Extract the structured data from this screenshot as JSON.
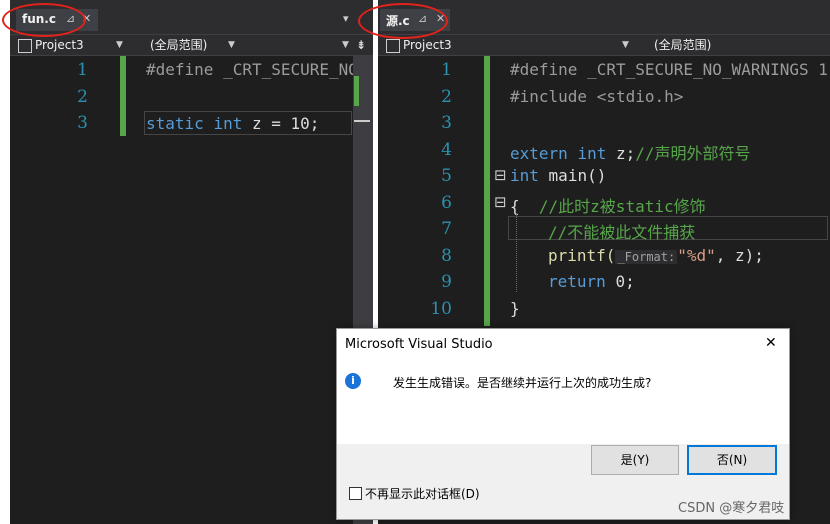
{
  "left_pane": {
    "tab": {
      "label": "fun.c",
      "pin": "⊿",
      "close": "✕"
    },
    "tab_menu": "▾",
    "nav": {
      "project": "Project3",
      "scope": "(全局范围)",
      "split": "⇟"
    },
    "lines": [
      {
        "num": "1",
        "code": "#define _CRT_SECURE_NO"
      },
      {
        "num": "2",
        "code": ""
      },
      {
        "num": "3",
        "code_kw1": "static",
        "code_kw2": "int",
        "code_rest": "z = 10;"
      }
    ]
  },
  "right_pane": {
    "tab": {
      "label": "源.c",
      "pin": "⊿",
      "close": "✕"
    },
    "nav": {
      "project": "Project3",
      "scope": "(全局范围)"
    },
    "lines": [
      {
        "num": "1",
        "code": "#define _CRT_SECURE_NO_WARNINGS 1"
      },
      {
        "num": "2",
        "code": "#include <stdio.h>"
      },
      {
        "num": "3",
        "code": ""
      },
      {
        "num": "4",
        "kw1": "extern",
        "kw2": "int",
        "rest": "z;",
        "comment": "//声明外部符号"
      },
      {
        "num": "5",
        "kw1": "int",
        "rest": "main()"
      },
      {
        "num": "6",
        "rest": "{",
        "comment": "//此时z被static修饰"
      },
      {
        "num": "7",
        "comment": "//不能被此文件捕获"
      },
      {
        "num": "8",
        "fn": "printf(",
        "hint": "_Format:",
        "str": "\"%d\"",
        "rest": ", z);"
      },
      {
        "num": "9",
        "kw1": "return",
        "rest": "0;"
      },
      {
        "num": "10",
        "rest": "}"
      }
    ],
    "fold_minus_1": "⊟",
    "fold_minus_2": "⊟"
  },
  "dialog": {
    "title": "Microsoft Visual Studio",
    "close": "✕",
    "info_icon": "info-icon",
    "message": "发生生成错误。是否继续并运行上次的成功生成?",
    "yes_label": "是(Y)",
    "no_label": "否(N)",
    "checkbox_label": "不再显示此对话框(D)"
  },
  "watermark": "CSDN @寒夕君吱",
  "colors": {
    "editor_bg": "#1e1e1e",
    "keyword": "#569cd6",
    "comment": "#57a64a",
    "string": "#d69d85",
    "highlight": "#e2231a"
  }
}
